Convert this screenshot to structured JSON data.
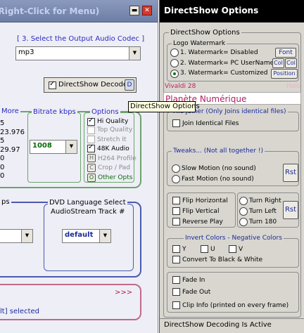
{
  "left": {
    "title": "(Right-Click for Menu)",
    "minimize_glyph": "▬",
    "close_glyph": "✕",
    "codec_label": "[ 3.  Select the Output Audio Codec ]",
    "codec_value": "mp3",
    "ds_decode_label": "DirectShow Decode",
    "ds_decode_btn": "D",
    "more_label": "More",
    "fps": [
      "5",
      "23.976",
      "5",
      "29.97",
      "0",
      "0",
      "0"
    ],
    "bitrate_label": "Bitrate  kbps",
    "bitrate_value": "1008",
    "options_label": "Options",
    "options": [
      {
        "label": "Hi Quality",
        "checked": true,
        "enabled": true
      },
      {
        "label": "Top Quality",
        "checked": false,
        "enabled": false
      },
      {
        "label": "Stretch It",
        "checked": false,
        "enabled": false
      },
      {
        "label": "48K Audio",
        "checked": true,
        "enabled": true
      }
    ],
    "profile_btns": [
      {
        "key": "H",
        "label": "H264 Profile"
      },
      {
        "key": "C",
        "label": "Crop / Pad"
      },
      {
        "key": "O",
        "label": "Other Opts"
      }
    ],
    "ps_label": "ps",
    "dvd_lang_line1": "DVD Language Select",
    "dvd_lang_line2": "AudioStream  Track #",
    "dvd_value": "default",
    "arrows": ">>>",
    "selected_text": "lt] selected"
  },
  "tooltip": "DirectShow Options",
  "right": {
    "title": "DirectShow Options",
    "group_title": "DirectShow Options",
    "logo_label": "Logo Watermark",
    "watermarks": [
      {
        "label": "1. Watermark= Disabled",
        "selected": false
      },
      {
        "label": "2. Watermark= PC UserName",
        "selected": false
      },
      {
        "label": "3. Watermark= Customized",
        "selected": true
      }
    ],
    "font_btn": "Font",
    "col_btn": "Col",
    "position_btn": "Position",
    "font_name": "Vivaldi 28",
    "halo_label": "Halo",
    "watermark_text": "Planète Numérique",
    "file_joiner_label": "File Joiner (Only Joins identical files)",
    "join_label": "Join Identical Files",
    "tweaks_label": "Tweaks... (Not all together !)",
    "slow_motion": "Slow Motion (no sound)",
    "fast_motion": "Fast Motion (no sound)",
    "rst": "Rst",
    "flips": [
      "Flip Horizontal",
      "Flip Vertical",
      "Reverse Play"
    ],
    "turns": [
      "Turn Right",
      "Turn Left",
      "Turn 180"
    ],
    "invert_label": "Invert Colors - Negative Colors",
    "y": "Y",
    "u": "U",
    "v": "V",
    "convert_bw": "Convert To Black & White",
    "fade_in": "Fade In",
    "fade_out": "Fade Out",
    "clip_info": "Clip Info (printed on every frame)",
    "status": "DirectShow Decoding Is Active"
  }
}
